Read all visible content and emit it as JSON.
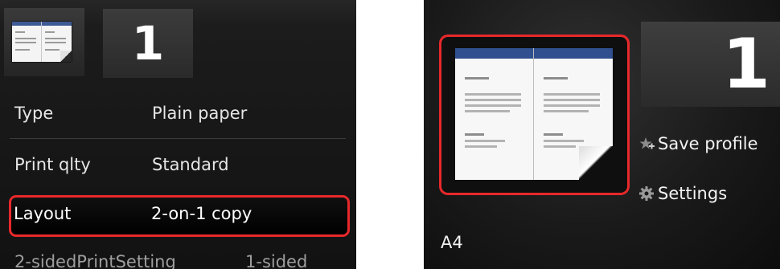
{
  "left_screen": {
    "copies": "1",
    "settings": [
      {
        "label": "Type",
        "value": "Plain paper"
      },
      {
        "label": "Print qlty",
        "value": "Standard"
      },
      {
        "label": "Layout",
        "value": "2-on-1 copy",
        "selected": true
      },
      {
        "label": "2-sidedPrintSetting",
        "value": "1-sided"
      }
    ]
  },
  "right_screen": {
    "copies": "1",
    "menu": [
      {
        "label": "Save profile",
        "icon": "star-plus-icon"
      },
      {
        "label": "Settings",
        "icon": "gear-icon"
      }
    ],
    "paper_size": "A4",
    "preview_icon": "two-on-one-layout-preview-icon"
  },
  "colors": {
    "highlight": "#e8282b",
    "header_bar": "#2f4f8f",
    "background": "#121212"
  }
}
